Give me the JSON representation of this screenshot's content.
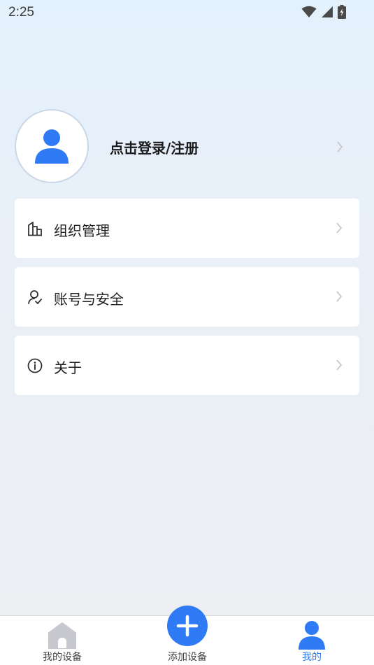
{
  "status_bar": {
    "time": "2:25",
    "icons": [
      "wifi-icon",
      "signal-icon",
      "battery-charging-icon"
    ]
  },
  "profile": {
    "login_label": "点击登录/注册",
    "avatar_icon": "user-icon"
  },
  "menu": {
    "items": [
      {
        "label": "组织管理",
        "icon": "building-icon"
      },
      {
        "label": "账号与安全",
        "icon": "user-shield-icon"
      },
      {
        "label": "关于",
        "icon": "info-icon"
      }
    ]
  },
  "bottom_nav": {
    "items": [
      {
        "label": "我的设备",
        "icon": "home-icon",
        "active": false
      },
      {
        "label": "添加设备",
        "icon": "plus-icon",
        "active": false
      },
      {
        "label": "我的",
        "icon": "user-icon",
        "active": true
      }
    ]
  },
  "colors": {
    "accent": "#2f7af5",
    "card_bg": "#ffffff",
    "inactive_icon": "#c7c7cf"
  }
}
